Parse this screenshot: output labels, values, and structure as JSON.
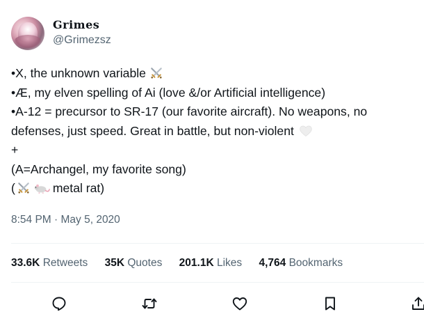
{
  "author": {
    "display_name": "Grimes",
    "handle": "@Grimezsz"
  },
  "tweet": {
    "lines": [
      "•X, the unknown variable",
      "•Æ, my elven spelling of Ai (love &/or Artificial intelligence)",
      "•A-12 = precursor to SR-17 (our favorite aircraft).  No weapons, no",
      "defenses, just speed.  Great in battle, but non-violent",
      "+",
      "(A=Archangel, my favorite song)",
      "(",
      "metal rat)"
    ],
    "emojis": [
      "crossed-swords",
      "white-heart",
      "crossed-swords",
      "rat"
    ]
  },
  "timestamp": "8:54 PM · May 5, 2020",
  "stats": {
    "retweets": {
      "value": "33.6K",
      "label": "Retweets"
    },
    "quotes": {
      "value": "35K",
      "label": "Quotes"
    },
    "likes": {
      "value": "201.1K",
      "label": "Likes"
    },
    "bookmarks": {
      "value": "4,764",
      "label": "Bookmarks"
    }
  },
  "actions": [
    "reply-icon",
    "retweet-icon",
    "like-icon",
    "bookmark-icon",
    "share-icon"
  ],
  "colors": {
    "text": "#0f1419",
    "secondary": "#536471",
    "divider": "#eff3f4"
  }
}
